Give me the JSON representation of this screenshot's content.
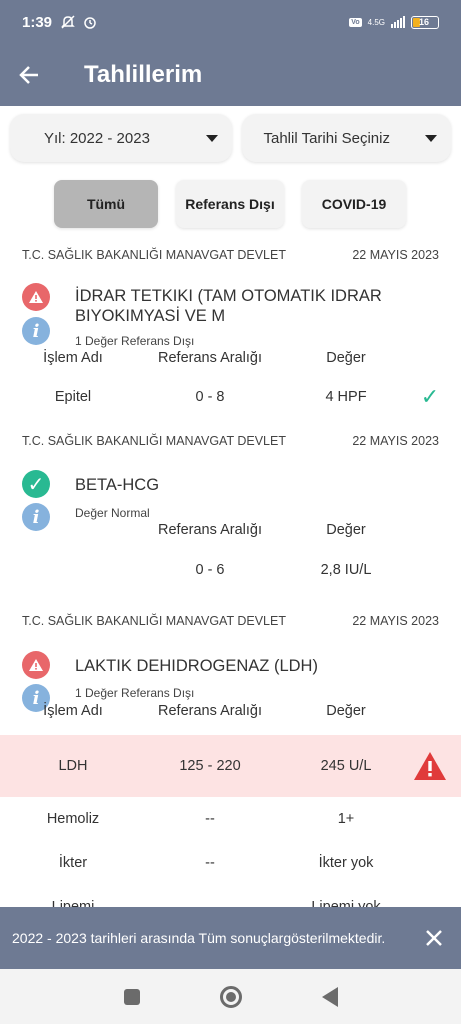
{
  "status_bar": {
    "time": "1:39",
    "network": "4.5G",
    "battery": "16"
  },
  "header": {
    "title": "Tahlillerim",
    "back_icon": "back-arrow-icon"
  },
  "filters": {
    "year": "Yıl: 2022 - 2023",
    "date": "Tahlil Tarihi Seçiniz"
  },
  "tabs": [
    {
      "label": "Tümü",
      "active": true
    },
    {
      "label": "Referans Dışı",
      "active": false
    },
    {
      "label": "COVID-19",
      "active": false
    }
  ],
  "results": [
    {
      "hospital": "T.C. SAĞLIK BAKANLIĞI MANAVGAT DEVLET",
      "date": "22 MAYIS 2023",
      "status": "warning",
      "title": "İDRAR TETKIKI (TAM OTOMATIK IDRAR BIYOKIMYASİ VE M",
      "subtitle": "1 Değer Referans Dışı",
      "col_name": "İşlem Adı",
      "col_ref": "Referans Aralığı",
      "col_value": "Değer",
      "rows": [
        {
          "name": "Epitel",
          "ref": "0 - 8",
          "value": "4 HPF",
          "flag": "ok"
        }
      ]
    },
    {
      "hospital": "T.C. SAĞLIK BAKANLIĞI MANAVGAT DEVLET",
      "date": "22 MAYIS 2023",
      "status": "ok",
      "title": "BETA-HCG",
      "subtitle": "Değer Normal",
      "col_ref": "Referans Aralığı",
      "col_value": "Değer",
      "rows": [
        {
          "ref": "0 - 6",
          "value": "2,8 IU/L"
        }
      ]
    },
    {
      "hospital": "T.C. SAĞLIK BAKANLIĞI MANAVGAT DEVLET",
      "date": "22 MAYIS 2023",
      "status": "warning",
      "title": "LAKTIK DEHIDROGENAZ (LDH)",
      "subtitle": "1 Değer Referans Dışı",
      "col_name": "İşlem Adı",
      "col_ref": "Referans Aralığı",
      "col_value": "Değer",
      "rows": [
        {
          "name": "LDH",
          "ref": "125 - 220",
          "value": "245 U/L",
          "flag": "warning"
        },
        {
          "name": "Hemoliz",
          "ref": "--",
          "value": "1+"
        },
        {
          "name": "İkter",
          "ref": "--",
          "value": "İkter yok"
        },
        {
          "name": "Lipemi",
          "value": "Lipemi yok"
        }
      ]
    }
  ],
  "snackbar": {
    "text": "2022 - 2023 tarihleri arasında Tüm sonuçlargösterilmektedir."
  },
  "colors": {
    "primary": "#6e7a93",
    "warning": "#e8676a",
    "ok": "#29b992",
    "info": "#86b2dd",
    "highlight": "#fde3e3"
  }
}
